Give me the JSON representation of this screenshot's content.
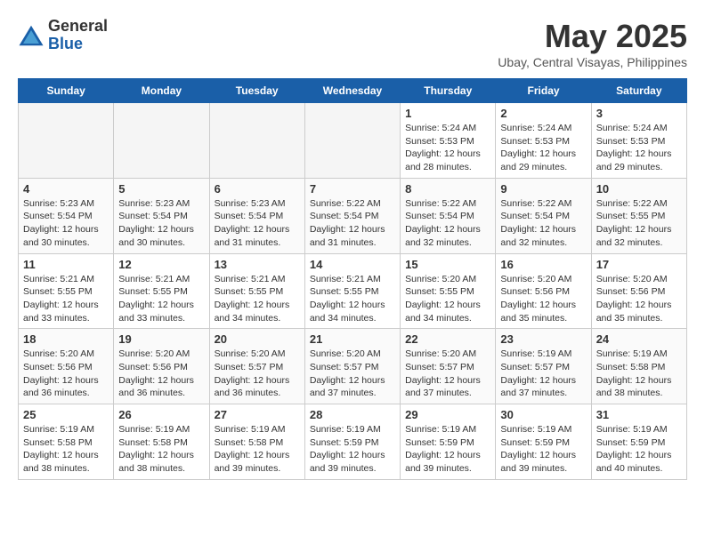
{
  "header": {
    "logo_general": "General",
    "logo_blue": "Blue",
    "month_year": "May 2025",
    "location": "Ubay, Central Visayas, Philippines"
  },
  "days_of_week": [
    "Sunday",
    "Monday",
    "Tuesday",
    "Wednesday",
    "Thursday",
    "Friday",
    "Saturday"
  ],
  "weeks": [
    [
      {
        "day": "",
        "info": ""
      },
      {
        "day": "",
        "info": ""
      },
      {
        "day": "",
        "info": ""
      },
      {
        "day": "",
        "info": ""
      },
      {
        "day": "1",
        "info": "Sunrise: 5:24 AM\nSunset: 5:53 PM\nDaylight: 12 hours\nand 28 minutes."
      },
      {
        "day": "2",
        "info": "Sunrise: 5:24 AM\nSunset: 5:53 PM\nDaylight: 12 hours\nand 29 minutes."
      },
      {
        "day": "3",
        "info": "Sunrise: 5:24 AM\nSunset: 5:53 PM\nDaylight: 12 hours\nand 29 minutes."
      }
    ],
    [
      {
        "day": "4",
        "info": "Sunrise: 5:23 AM\nSunset: 5:54 PM\nDaylight: 12 hours\nand 30 minutes."
      },
      {
        "day": "5",
        "info": "Sunrise: 5:23 AM\nSunset: 5:54 PM\nDaylight: 12 hours\nand 30 minutes."
      },
      {
        "day": "6",
        "info": "Sunrise: 5:23 AM\nSunset: 5:54 PM\nDaylight: 12 hours\nand 31 minutes."
      },
      {
        "day": "7",
        "info": "Sunrise: 5:22 AM\nSunset: 5:54 PM\nDaylight: 12 hours\nand 31 minutes."
      },
      {
        "day": "8",
        "info": "Sunrise: 5:22 AM\nSunset: 5:54 PM\nDaylight: 12 hours\nand 32 minutes."
      },
      {
        "day": "9",
        "info": "Sunrise: 5:22 AM\nSunset: 5:54 PM\nDaylight: 12 hours\nand 32 minutes."
      },
      {
        "day": "10",
        "info": "Sunrise: 5:22 AM\nSunset: 5:55 PM\nDaylight: 12 hours\nand 32 minutes."
      }
    ],
    [
      {
        "day": "11",
        "info": "Sunrise: 5:21 AM\nSunset: 5:55 PM\nDaylight: 12 hours\nand 33 minutes."
      },
      {
        "day": "12",
        "info": "Sunrise: 5:21 AM\nSunset: 5:55 PM\nDaylight: 12 hours\nand 33 minutes."
      },
      {
        "day": "13",
        "info": "Sunrise: 5:21 AM\nSunset: 5:55 PM\nDaylight: 12 hours\nand 34 minutes."
      },
      {
        "day": "14",
        "info": "Sunrise: 5:21 AM\nSunset: 5:55 PM\nDaylight: 12 hours\nand 34 minutes."
      },
      {
        "day": "15",
        "info": "Sunrise: 5:20 AM\nSunset: 5:55 PM\nDaylight: 12 hours\nand 34 minutes."
      },
      {
        "day": "16",
        "info": "Sunrise: 5:20 AM\nSunset: 5:56 PM\nDaylight: 12 hours\nand 35 minutes."
      },
      {
        "day": "17",
        "info": "Sunrise: 5:20 AM\nSunset: 5:56 PM\nDaylight: 12 hours\nand 35 minutes."
      }
    ],
    [
      {
        "day": "18",
        "info": "Sunrise: 5:20 AM\nSunset: 5:56 PM\nDaylight: 12 hours\nand 36 minutes."
      },
      {
        "day": "19",
        "info": "Sunrise: 5:20 AM\nSunset: 5:56 PM\nDaylight: 12 hours\nand 36 minutes."
      },
      {
        "day": "20",
        "info": "Sunrise: 5:20 AM\nSunset: 5:57 PM\nDaylight: 12 hours\nand 36 minutes."
      },
      {
        "day": "21",
        "info": "Sunrise: 5:20 AM\nSunset: 5:57 PM\nDaylight: 12 hours\nand 37 minutes."
      },
      {
        "day": "22",
        "info": "Sunrise: 5:20 AM\nSunset: 5:57 PM\nDaylight: 12 hours\nand 37 minutes."
      },
      {
        "day": "23",
        "info": "Sunrise: 5:19 AM\nSunset: 5:57 PM\nDaylight: 12 hours\nand 37 minutes."
      },
      {
        "day": "24",
        "info": "Sunrise: 5:19 AM\nSunset: 5:58 PM\nDaylight: 12 hours\nand 38 minutes."
      }
    ],
    [
      {
        "day": "25",
        "info": "Sunrise: 5:19 AM\nSunset: 5:58 PM\nDaylight: 12 hours\nand 38 minutes."
      },
      {
        "day": "26",
        "info": "Sunrise: 5:19 AM\nSunset: 5:58 PM\nDaylight: 12 hours\nand 38 minutes."
      },
      {
        "day": "27",
        "info": "Sunrise: 5:19 AM\nSunset: 5:58 PM\nDaylight: 12 hours\nand 39 minutes."
      },
      {
        "day": "28",
        "info": "Sunrise: 5:19 AM\nSunset: 5:59 PM\nDaylight: 12 hours\nand 39 minutes."
      },
      {
        "day": "29",
        "info": "Sunrise: 5:19 AM\nSunset: 5:59 PM\nDaylight: 12 hours\nand 39 minutes."
      },
      {
        "day": "30",
        "info": "Sunrise: 5:19 AM\nSunset: 5:59 PM\nDaylight: 12 hours\nand 39 minutes."
      },
      {
        "day": "31",
        "info": "Sunrise: 5:19 AM\nSunset: 5:59 PM\nDaylight: 12 hours\nand 40 minutes."
      }
    ]
  ]
}
